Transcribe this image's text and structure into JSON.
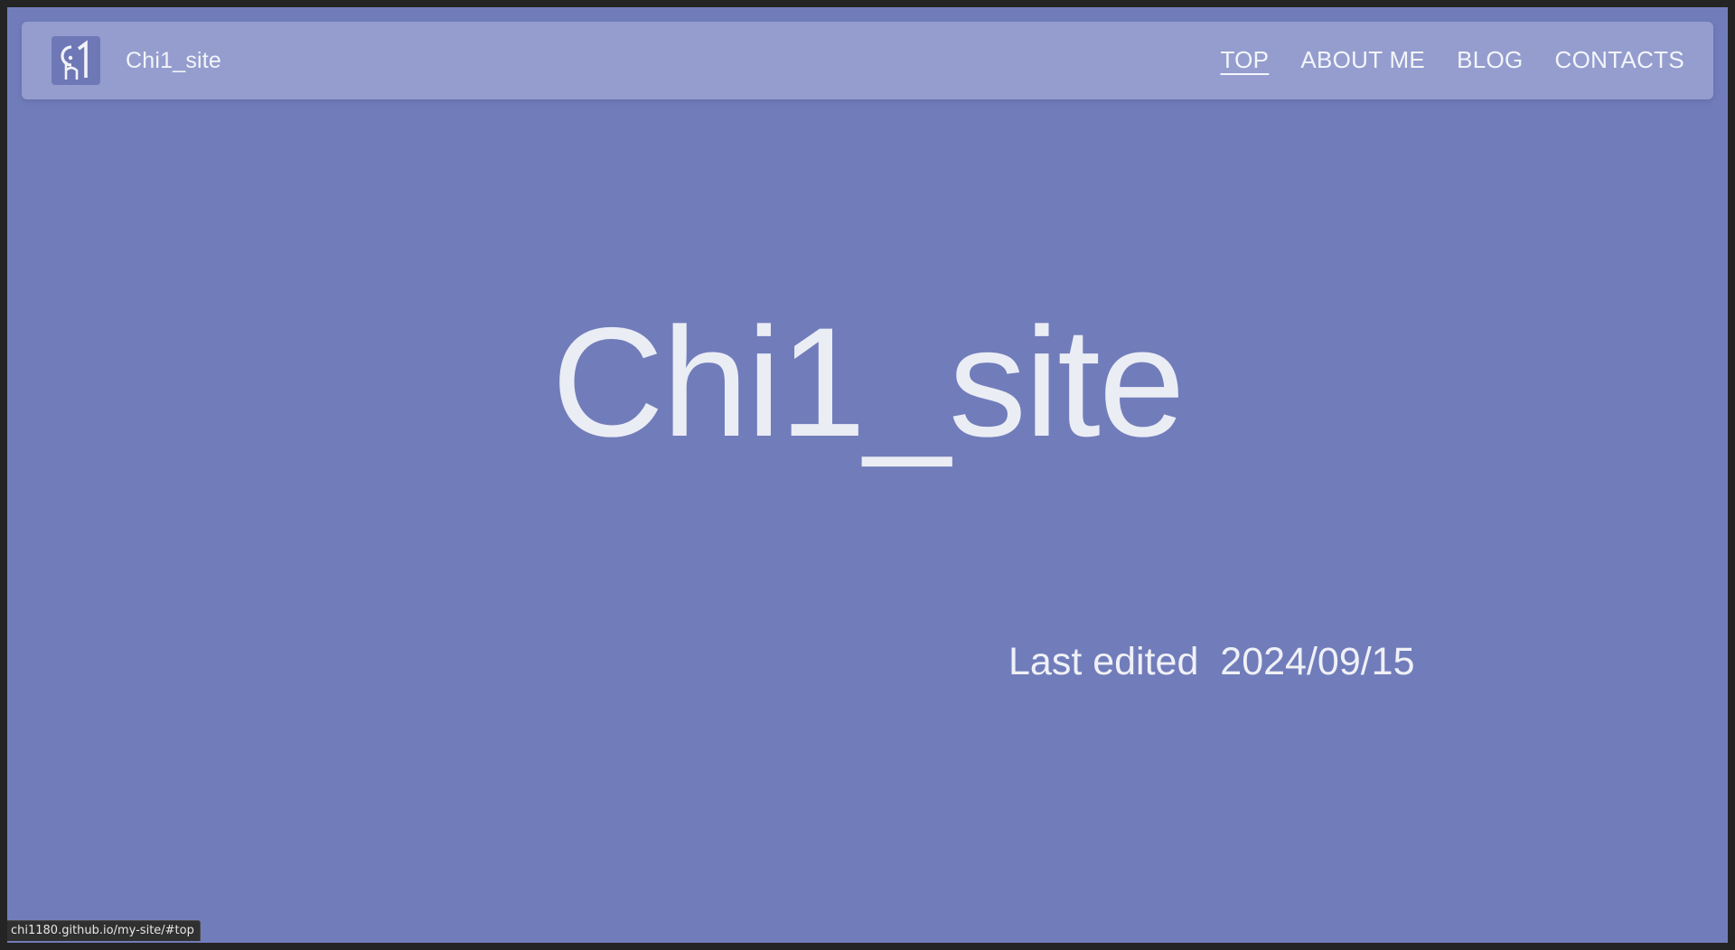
{
  "site": {
    "brand_name": "Chi1_site",
    "logo_icon": "chi1-logo-icon"
  },
  "nav": {
    "items": [
      {
        "label": "TOP",
        "active": true
      },
      {
        "label": "ABOUT ME",
        "active": false
      },
      {
        "label": "BLOG",
        "active": false
      },
      {
        "label": "CONTACTS",
        "active": false
      }
    ]
  },
  "hero": {
    "title": "Chi1_site",
    "last_edited_label": "Last edited",
    "last_edited_date": "2024/09/15"
  },
  "status_bar": {
    "url": "chi1180.github.io/my-site/#top"
  },
  "colors": {
    "background": "#717dba",
    "navbar": "#949dce",
    "text": "#ebedf5"
  }
}
